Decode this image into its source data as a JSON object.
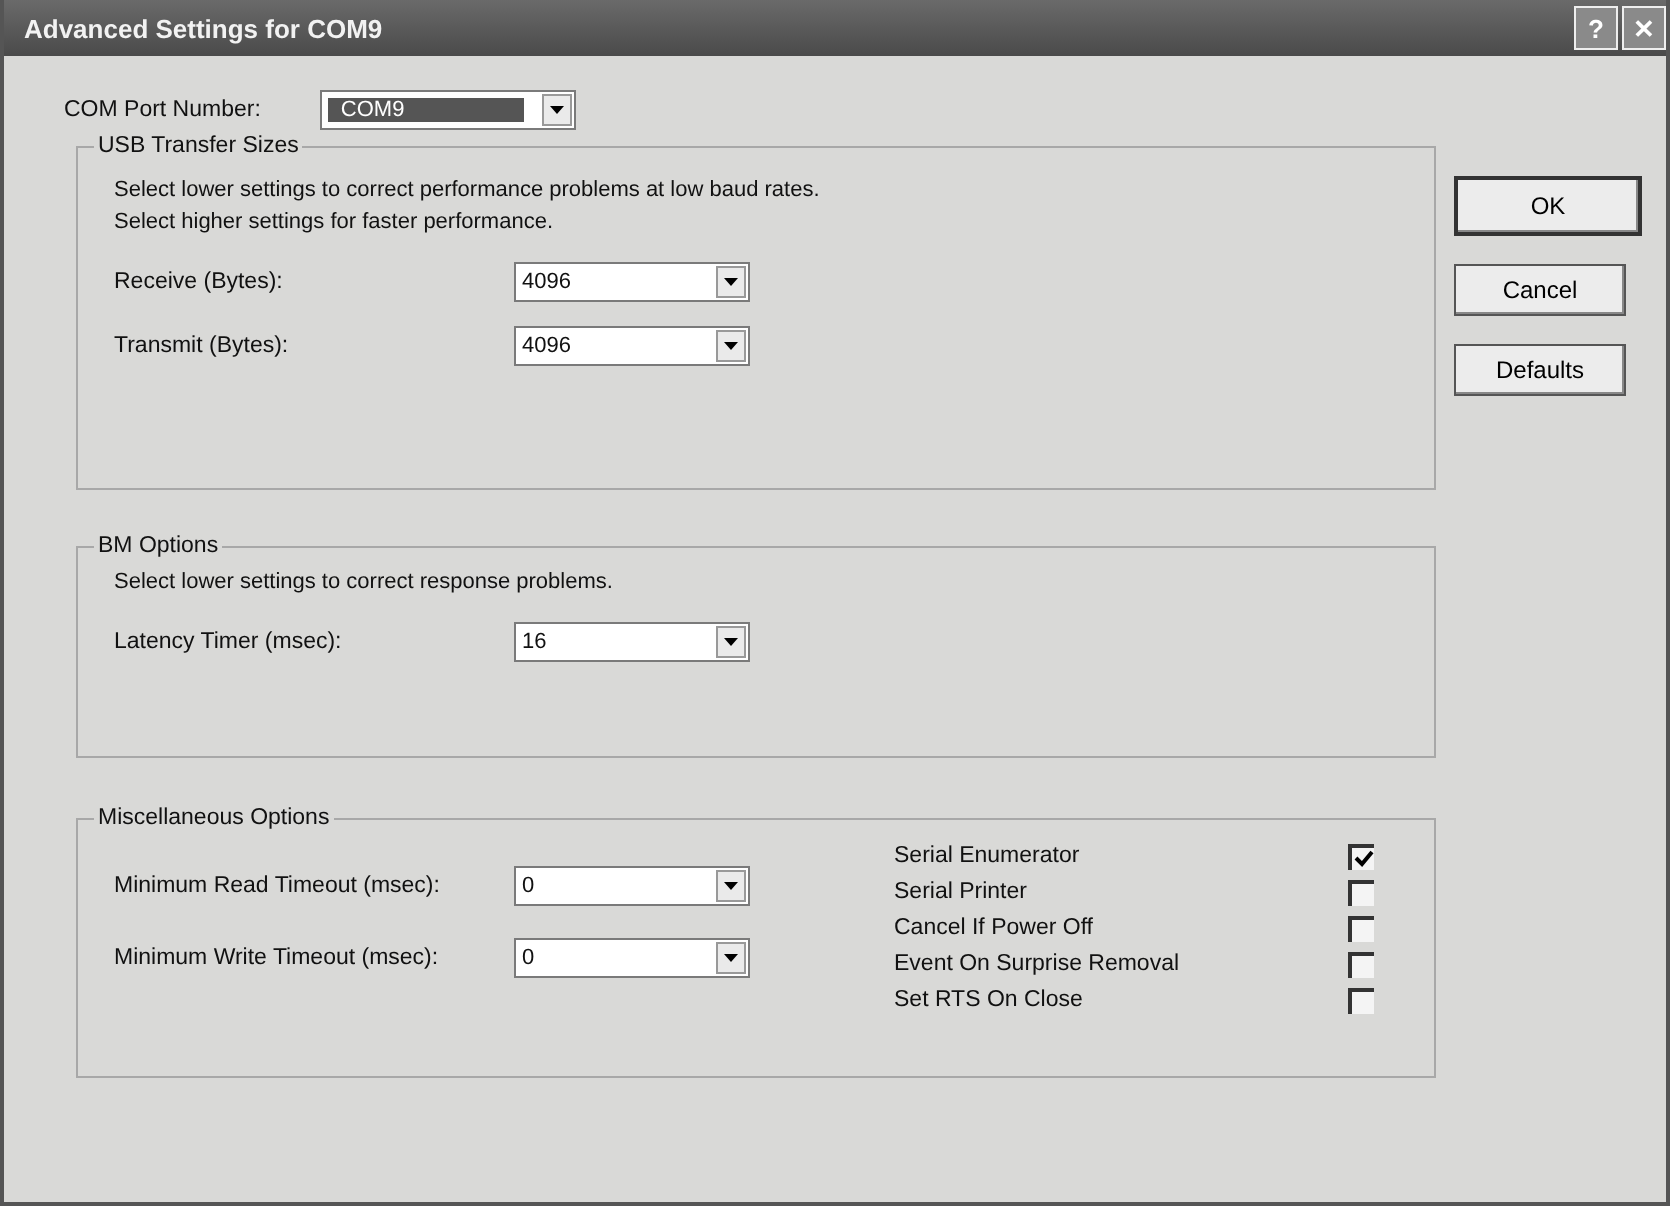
{
  "window": {
    "title": "Advanced Settings for COM9",
    "title_buttons": [
      "?",
      "✕"
    ]
  },
  "com_port": {
    "label": "COM Port Number:",
    "value": "COM9",
    "selected": true
  },
  "buttons": [
    "OK",
    "Cancel",
    "Defaults"
  ],
  "groups": [
    {
      "title": "USB Transfer Sizes",
      "notes": [
        "Select lower settings to correct performance problems at low baud rates.",
        "Select higher settings for faster performance."
      ],
      "fields": [
        {
          "label": "Receive (Bytes):",
          "value": "4096"
        },
        {
          "label": "Transmit (Bytes):",
          "value": "4096"
        }
      ]
    },
    {
      "title": "BM Options",
      "notes": [
        "Select lower settings to correct response problems."
      ],
      "fields": [
        {
          "label": "Latency Timer (msec):",
          "value": "16"
        }
      ]
    }
  ],
  "misc": {
    "title": "Miscellaneous Options",
    "fields": [
      {
        "label": "Minimum Read Timeout (msec):",
        "value": "0"
      },
      {
        "label": "Minimum Write Timeout (msec):",
        "value": "0"
      }
    ],
    "options": [
      {
        "label": "Serial Enumerator",
        "checked": true
      },
      {
        "label": "Serial Printer",
        "checked": false
      },
      {
        "label": "Cancel If Power Off",
        "checked": false
      },
      {
        "label": "Event On Surprise Removal",
        "checked": false
      },
      {
        "label": "Set RTS On Close",
        "checked": false
      }
    ]
  }
}
